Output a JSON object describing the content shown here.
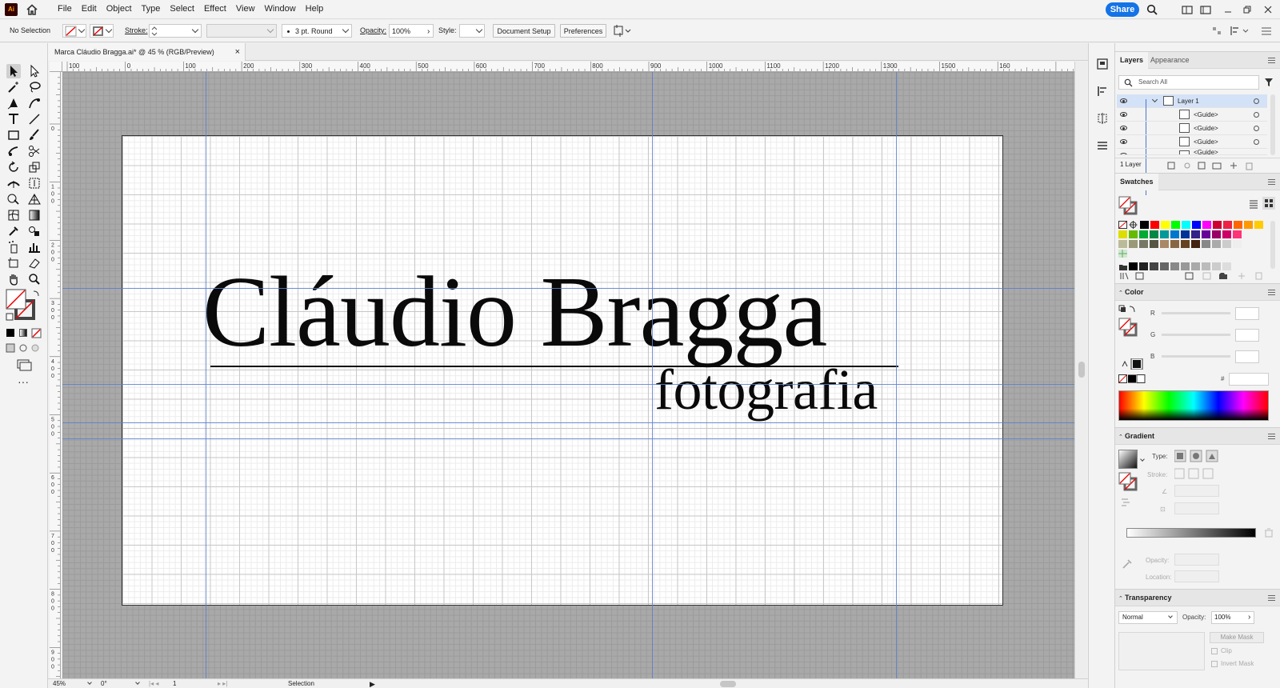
{
  "app": {
    "logo_text": "Ai"
  },
  "menu": {
    "items": [
      "File",
      "Edit",
      "Object",
      "Type",
      "Select",
      "Effect",
      "View",
      "Window",
      "Help"
    ],
    "share_label": "Share"
  },
  "control_bar": {
    "selection_label": "No Selection",
    "stroke_label": "Stroke:",
    "brush_label": "3 pt. Round",
    "opacity_label": "Opacity:",
    "opacity_value": "100%",
    "style_label": "Style:",
    "document_setup_label": "Document Setup",
    "preferences_label": "Preferences"
  },
  "document": {
    "tab_title": "Marca Cláudio Bragga.ai* @ 45 % (RGB/Preview)",
    "close_glyph": "×"
  },
  "artwork": {
    "main_text": "Cláudio Bragga",
    "sub_text": "fotografia"
  },
  "rulers": {
    "top_labels": [
      "100",
      "0",
      "100",
      "200",
      "300",
      "400",
      "500",
      "600",
      "700",
      "800",
      "900",
      "1000",
      "1100",
      "1200",
      "1300",
      "1500",
      "160"
    ],
    "left_labels": [
      "0",
      "1 0 0",
      "2 0 0",
      "3 0 0",
      "4 0 0",
      "5 0 0",
      "6 0 0",
      "7 0 0",
      "8 0 0",
      "9 0 0"
    ]
  },
  "status": {
    "zoom": "45%",
    "rotation": "0°",
    "artboard_number": "1",
    "tool_label": "Selection"
  },
  "layers_panel": {
    "tab_layers": "Layers",
    "tab_appearance": "Appearance",
    "search_placeholder": "Search All",
    "rows": [
      {
        "name": "Layer 1"
      },
      {
        "name": "<Guide>"
      },
      {
        "name": "<Guide>"
      },
      {
        "name": "<Guide>"
      },
      {
        "name": "<Guide>"
      }
    ],
    "footer_count": "1 Layer"
  },
  "swatches_panel": {
    "title": "Swatches",
    "row1": [
      "#000000",
      "#ff0000",
      "#ffff00",
      "#00ff00",
      "#00ffff",
      "#0000ff",
      "#ff00ff",
      "#cc0033",
      "#ee2244",
      "#ff6600",
      "#ff9900",
      "#ffcc00"
    ],
    "row2": [
      "#dddd00",
      "#66bb00",
      "#00aa33",
      "#008844",
      "#009999",
      "#0077cc",
      "#003399",
      "#332288",
      "#660099",
      "#990066",
      "#cc0066",
      "#ff3377"
    ],
    "row3": [
      "#bbbb99",
      "#999977",
      "#777766",
      "#555544",
      "#aa8866",
      "#886644",
      "#664422",
      "#442211",
      "#888888",
      "#aaaaaa",
      "#cccccc",
      "#eeeeee"
    ],
    "row4": [
      "#000000",
      "#222222",
      "#444444",
      "#666666",
      "#888888",
      "#999999",
      "#aaaaaa",
      "#bbbbbb",
      "#cccccc",
      "#dddddd"
    ]
  },
  "color_panel": {
    "title": "Color",
    "label_r": "R",
    "label_g": "G",
    "label_b": "B",
    "label_hex": "#"
  },
  "gradient_panel": {
    "title": "Gradient",
    "type_label": "Type:",
    "stroke_label": "Stroke:",
    "opacity_label": "Opacity:",
    "location_label": "Location:"
  },
  "transparency_panel": {
    "title": "Transparency",
    "blend_mode": "Normal",
    "opacity_label": "Opacity:",
    "opacity_value": "100%",
    "make_mask_label": "Make Mask",
    "clip_label": "Clip",
    "invert_mask_label": "Invert Mask"
  }
}
